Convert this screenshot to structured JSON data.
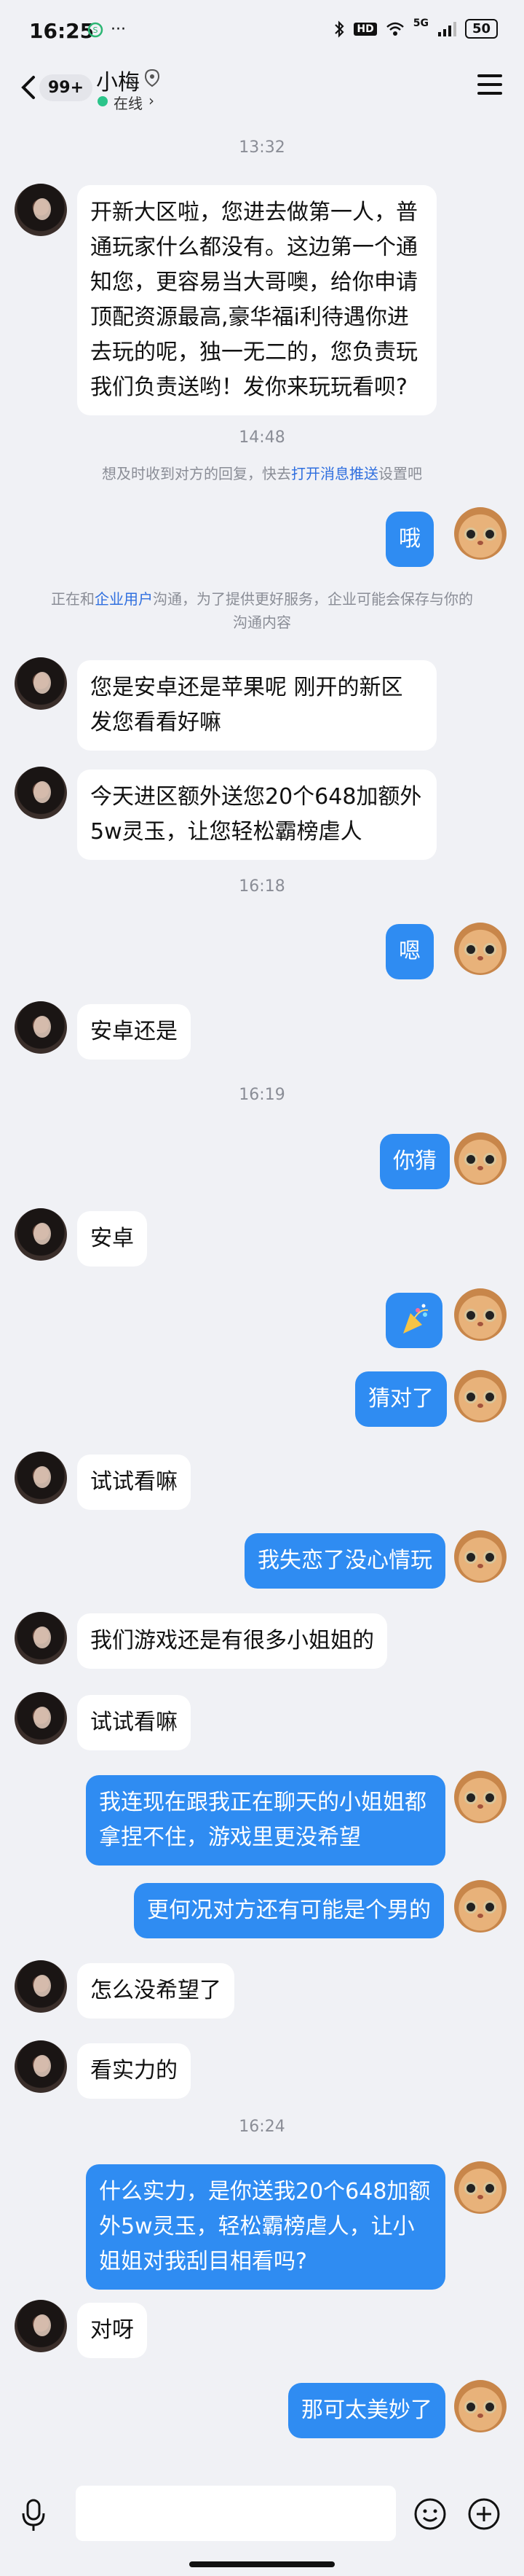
{
  "status_bar": {
    "time": "16:25",
    "hd_label": "HD",
    "network": "5G",
    "battery": "50"
  },
  "header": {
    "unread_count": "99+",
    "contact_name": "小梅",
    "status": "在线",
    "status_chevron": "›"
  },
  "notices": {
    "t1": "13:32",
    "t2": "14:48",
    "n1_before": "想及时收到对方的回复，快去",
    "n1_link": "打开消息推送",
    "n1_after": "设置吧",
    "n2_before": "正在和",
    "n2_link": "企业用户",
    "n2_after": "沟通，为了提供更好服务，企业可能会保存与你的",
    "n2_line2": "沟通内容",
    "t3": "16:18",
    "t4": "16:19",
    "t5": "16:24"
  },
  "messages": [
    {
      "side": "in",
      "text": "开新大区啦，您进去做第一人，普通玩家什么都没有。这边第一个通知您，更容易当大哥噢，给你申请顶配资源最高,豪华福i利待遇你进去玩的呢，独一无二的，您负责玩我们负责送哟！发你来玩玩看呗?"
    },
    {
      "side": "out",
      "text": "哦"
    },
    {
      "side": "in",
      "text": "您是安卓还是苹果呢 刚开的新区发您看看好嘛"
    },
    {
      "side": "in",
      "text": "今天进区额外送您20个648加额外5w灵玉，让您轻松霸榜虐人"
    },
    {
      "side": "out",
      "text": "嗯"
    },
    {
      "side": "in",
      "text": "安卓还是"
    },
    {
      "side": "out",
      "text": "你猜"
    },
    {
      "side": "in",
      "text": "安卓"
    },
    {
      "side": "out",
      "text": "[party-popper]"
    },
    {
      "side": "out",
      "text": "猜对了"
    },
    {
      "side": "in",
      "text": "试试看嘛"
    },
    {
      "side": "out",
      "text": "我失恋了没心情玩"
    },
    {
      "side": "in",
      "text": "我们游戏还是有很多小姐姐的"
    },
    {
      "side": "in",
      "text": "试试看嘛"
    },
    {
      "side": "out",
      "text": "我连现在跟我正在聊天的小姐姐都拿捏不住，游戏里更没希望"
    },
    {
      "side": "out",
      "text": "更何况对方还有可能是个男的"
    },
    {
      "side": "in",
      "text": "怎么没希望了"
    },
    {
      "side": "in",
      "text": "看实力的"
    },
    {
      "side": "out",
      "text": "什么实力，是你送我20个648加额外5w灵玉，轻松霸榜虐人，让小姐姐对我刮目相看吗?"
    },
    {
      "side": "in",
      "text": "对呀"
    },
    {
      "side": "out",
      "text": "那可太美妙了"
    }
  ],
  "colors": {
    "background": "#f0f1f5",
    "bubble_out": "#2f8cf2",
    "bubble_in": "#ffffff",
    "link": "#2f6fdf",
    "online": "#2bc48a"
  },
  "icons": [
    "back-arrow-icon",
    "info-icon",
    "menu-icon",
    "mic-icon",
    "smile-icon",
    "plus-icon",
    "party-popper-icon"
  ]
}
